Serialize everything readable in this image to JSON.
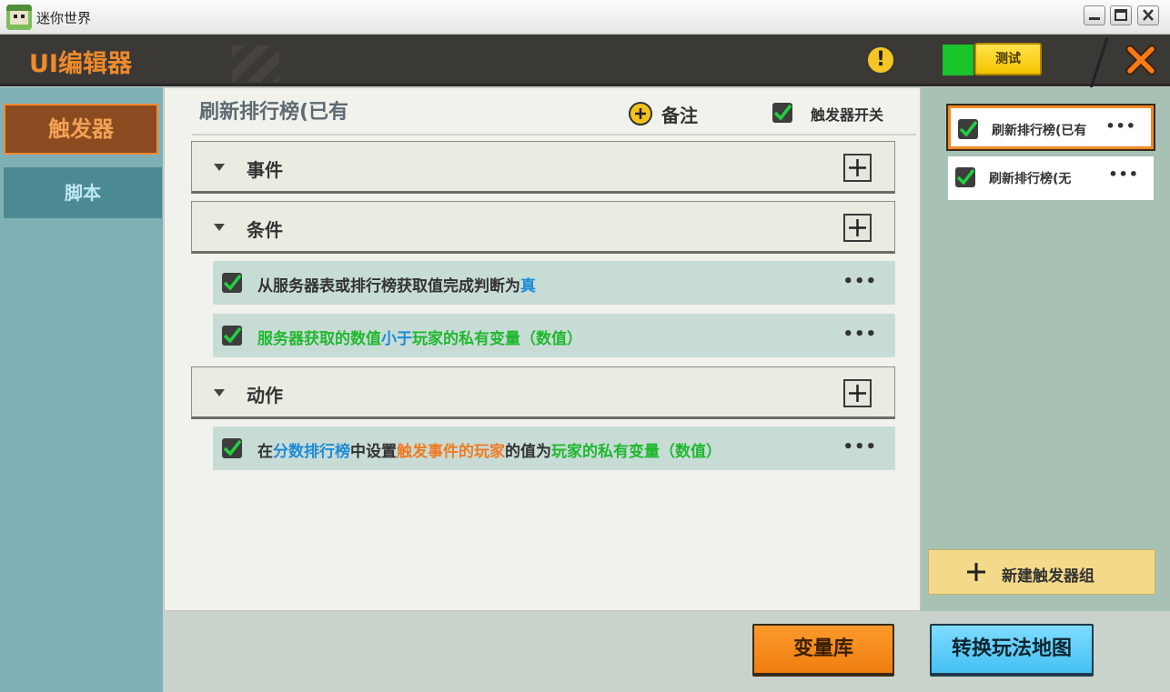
{
  "window": {
    "title": "迷你世界"
  },
  "header": {
    "title": "UI编辑器",
    "warning_glyph": "!",
    "test_label": "测试"
  },
  "sidebar": {
    "tabs": [
      {
        "label": "触发器",
        "active": true
      },
      {
        "label": "脚本",
        "active": false
      }
    ]
  },
  "main": {
    "trigger_name": "刷新排行榜(已有",
    "note_label": "备注",
    "switch_label": "触发器开关",
    "switch_checked": true,
    "sections": {
      "event": {
        "label": "事件"
      },
      "condition": {
        "label": "条件"
      },
      "action": {
        "label": "动作"
      }
    },
    "conditions": [
      {
        "parts": [
          {
            "text": "从服务器表或排行榜获取值完成判断为",
            "color": "#333333"
          },
          {
            "text": "真",
            "color": "#1e8bd6"
          }
        ],
        "more": "•••"
      },
      {
        "parts": [
          {
            "text": "服务器获取的数值",
            "color": "#20b82e"
          },
          {
            "text": "小于",
            "color": "#1e8bd6"
          },
          {
            "text": "玩家的私有变量（数值）",
            "color": "#20b82e"
          }
        ],
        "more": "•••"
      }
    ],
    "actions": [
      {
        "parts": [
          {
            "text": "在",
            "color": "#333333"
          },
          {
            "text": "分数排行榜",
            "color": "#1e8bd6"
          },
          {
            "text": "中设置",
            "color": "#333333"
          },
          {
            "text": "触发事件的玩家",
            "color": "#ef7b22"
          },
          {
            "text": "的值为",
            "color": "#333333"
          },
          {
            "text": "玩家的私有变量（数值）",
            "color": "#20b82e"
          }
        ],
        "more": "•••"
      }
    ]
  },
  "trigger_groups": {
    "items": [
      {
        "label": "刷新排行榜(已有",
        "selected": true,
        "checked": true,
        "more": "•••"
      },
      {
        "label": "刷新排行榜(无",
        "selected": false,
        "checked": true,
        "more": "•••"
      }
    ],
    "new_group_label": "新建触发器组"
  },
  "bottom": {
    "variable_library": "变量库",
    "convert_map": "转换玩法地图"
  },
  "colors": {
    "accent_orange": "#f08a2a",
    "check_green": "#20d040",
    "header_bg": "#3b3936"
  }
}
